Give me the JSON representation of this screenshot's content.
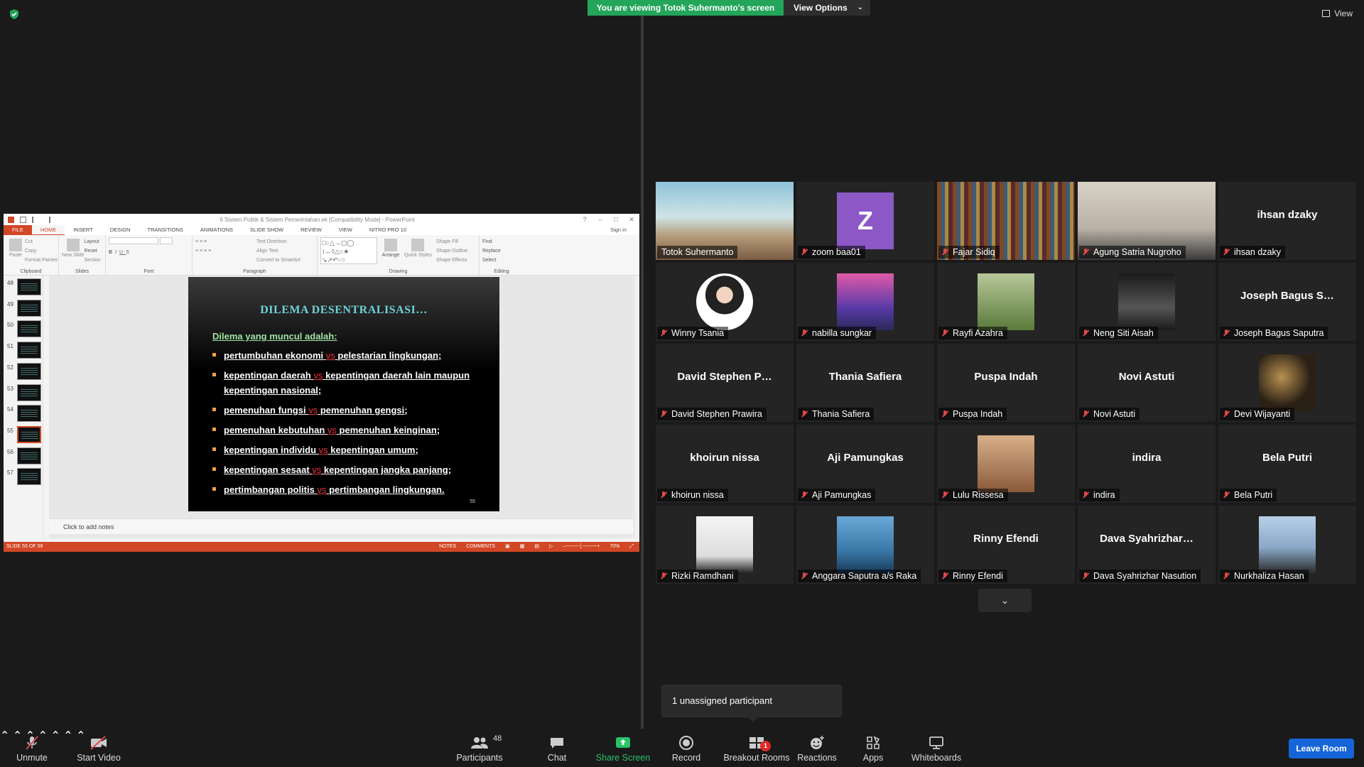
{
  "top": {
    "viewing_banner": "You are viewing Totok Suhermanto's screen",
    "view_options": "View Options",
    "view": "View"
  },
  "ppt": {
    "doc_title": "6 Sistem Politik & Sistem Pemerintahan.ek [Compatibility Mode] - PowerPoint",
    "tabs": [
      "FILE",
      "HOME",
      "INSERT",
      "DESIGN",
      "TRANSITIONS",
      "ANIMATIONS",
      "SLIDE SHOW",
      "REVIEW",
      "VIEW",
      "NITRO PRO 10"
    ],
    "sign_in": "Sign in",
    "ribbon": {
      "clipboard": {
        "label": "Clipboard",
        "paste": "Paste",
        "cut": "Cut",
        "copy": "Copy",
        "format_painter": "Format Painter"
      },
      "slides": {
        "label": "Slides",
        "new_slide": "New Slide",
        "layout": "Layout",
        "reset": "Reset",
        "section": "Section"
      },
      "font": {
        "label": "Font"
      },
      "paragraph": {
        "label": "Paragraph",
        "text_direction": "Text Direction",
        "align_text": "Align Text",
        "convert": "Convert to SmartArt"
      },
      "drawing": {
        "label": "Drawing",
        "arrange": "Arrange",
        "quick_styles": "Quick Styles",
        "shape_fill": "Shape Fill",
        "shape_outline": "Shape Outline",
        "shape_effects": "Shape Effects"
      },
      "editing": {
        "label": "Editing",
        "find": "Find",
        "replace": "Replace",
        "select": "Select"
      }
    },
    "thumbs": [
      "48",
      "49",
      "50",
      "51",
      "52",
      "53",
      "54",
      "55",
      "56",
      "57"
    ],
    "selected_thumb": "55",
    "slide": {
      "title": "DILEMA DESENTRALISASI…",
      "intro": "Dilema yang muncul adalah:",
      "bullets": [
        {
          "a": "pertumbuhan ekonomi",
          "b": "pelestarian lingkungan;"
        },
        {
          "a": "kepentingan daerah",
          "b": "kepentingan daerah lain maupun kepentingan nasional;"
        },
        {
          "a": "pemenuhan fungsi",
          "b": "pemenuhan gengsi;"
        },
        {
          "a": "pemenuhan kebutuhan",
          "b": "pemenuhan keinginan;"
        },
        {
          "a": "kepentingan individu",
          "b": "kepentingan umum;"
        },
        {
          "a": "kepentingan sesaat",
          "b": "kepentingan jangka panjang;"
        },
        {
          "a": "pertimbangan politis",
          "b": "pertimbangan lingkungan."
        }
      ],
      "vs": "vs",
      "page_num": "55"
    },
    "notes_placeholder": "Click to add notes",
    "status": {
      "slide": "SLIDE 55 OF 59",
      "notes": "NOTES",
      "comments": "COMMENTS",
      "zoom": "70%"
    }
  },
  "participants": [
    {
      "name": "Totok Suhermanto",
      "big": "",
      "muted": false
    },
    {
      "name": "zoom baa01",
      "big": "",
      "muted": true
    },
    {
      "name": "Fajar Sidiq",
      "big": "",
      "muted": true
    },
    {
      "name": "Agung Satria Nugroho",
      "big": "",
      "muted": true
    },
    {
      "name": "ihsan dzaky",
      "big": "ihsan dzaky",
      "muted": true
    },
    {
      "name": "Winny Tsania",
      "big": "",
      "muted": true
    },
    {
      "name": "nabilla sungkar",
      "big": "",
      "muted": true
    },
    {
      "name": "Rayfi Azahra",
      "big": "",
      "muted": true
    },
    {
      "name": "Neng Siti Aisah",
      "big": "",
      "muted": true
    },
    {
      "name": "Joseph Bagus Saputra",
      "big": "Joseph Bagus S…",
      "muted": true
    },
    {
      "name": "David Stephen Prawira",
      "big": "David  Stephen  P…",
      "muted": true
    },
    {
      "name": "Thania Safiera",
      "big": "Thania Safiera",
      "muted": true
    },
    {
      "name": "Puspa Indah",
      "big": "Puspa Indah",
      "muted": true
    },
    {
      "name": "Novi Astuti",
      "big": "Novi Astuti",
      "muted": true
    },
    {
      "name": "Devi Wijayanti",
      "big": "",
      "muted": true
    },
    {
      "name": "khoirun nissa",
      "big": "khoirun nissa",
      "muted": true
    },
    {
      "name": "Aji Pamungkas",
      "big": "Aji Pamungkas",
      "muted": true
    },
    {
      "name": "Lulu Rissesa",
      "big": "",
      "muted": true
    },
    {
      "name": "indira",
      "big": "indira",
      "muted": true
    },
    {
      "name": "Bela Putri",
      "big": "Bela Putri",
      "muted": true
    },
    {
      "name": "Rizki Ramdhani",
      "big": "",
      "muted": true
    },
    {
      "name": "Anggara Saputra a/s Raka",
      "big": "",
      "muted": true
    },
    {
      "name": "Rinny Efendi",
      "big": "Rinny Efendi",
      "muted": true
    },
    {
      "name": "Dava Syahrizhar Nasution",
      "big": "Dava  Syahrizhar…",
      "muted": true
    },
    {
      "name": "Nurkhaliza Hasan",
      "big": "",
      "muted": true
    }
  ],
  "avatar_letter": "Z",
  "unassigned": "1 unassigned participant",
  "toolbar": {
    "unmute": "Unmute",
    "start_video": "Start Video",
    "participants": "Participants",
    "participants_count": "48",
    "chat": "Chat",
    "share_screen": "Share Screen",
    "record": "Record",
    "breakout_rooms": "Breakout Rooms",
    "breakout_badge": "1",
    "reactions": "Reactions",
    "apps": "Apps",
    "whiteboards": "Whiteboards",
    "leave": "Leave Room"
  },
  "colors": {
    "accent_green": "#23a55a",
    "leave_blue": "#1565d8",
    "ppt_orange": "#d24726",
    "active_speaker": "#d1e34c"
  }
}
